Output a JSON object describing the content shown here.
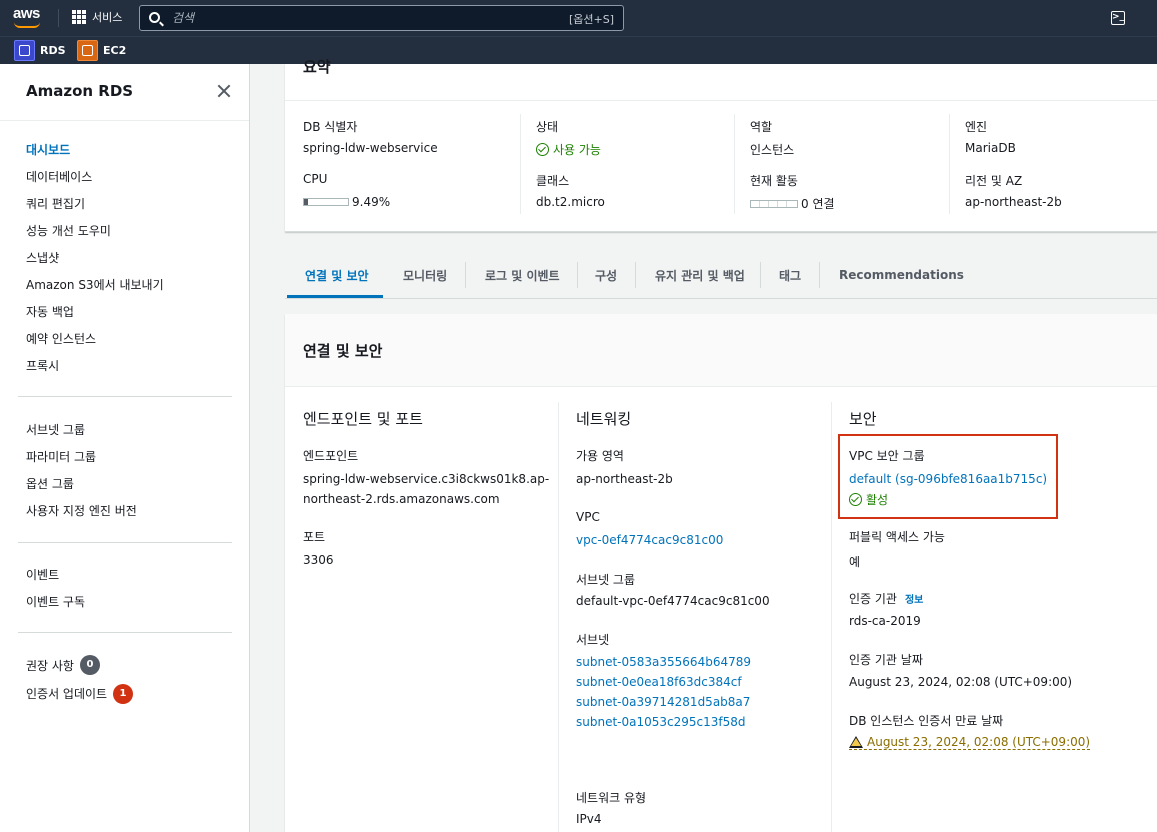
{
  "topnav": {
    "logo_text": "aws",
    "services_label": "서비스",
    "search_placeholder": "검색",
    "search_shortcut": "[옵션+S]",
    "cloudshell_icon": "cloudshell-icon",
    "favorites": [
      {
        "label": "RDS",
        "icon": "rds-icon",
        "color": "#3b48cc"
      },
      {
        "label": "EC2",
        "icon": "ec2-icon",
        "color": "#d86613"
      }
    ]
  },
  "sidebar": {
    "title": "Amazon RDS",
    "section1": [
      "대시보드",
      "데이터베이스",
      "쿼리 편집기",
      "성능 개선 도우미",
      "스냅샷",
      "Amazon S3에서 내보내기",
      "자동 백업",
      "예약 인스턴스",
      "프록시"
    ],
    "section2": [
      "서브넷 그룹",
      "파라미터 그룹",
      "옵션 그룹",
      "사용자 지정 엔진 버전"
    ],
    "section3": [
      "이벤트",
      "이벤트 구독"
    ],
    "section4": [
      {
        "label": "권장 사항",
        "badge": "0"
      },
      {
        "label": "인증서 업데이트",
        "badge": "1"
      }
    ]
  },
  "summary": {
    "title_partial": "요약",
    "db_id_label": "DB 식별자",
    "db_id_value": "spring-ldw-webservice",
    "cpu_label": "CPU",
    "cpu_value": "9.49%",
    "cpu_fraction": 0.0949,
    "status_label": "상태",
    "status_value": "사용 가능",
    "class_label": "클래스",
    "class_value": "db.t2.micro",
    "role_label": "역할",
    "role_value": "인스턴스",
    "activity_label": "현재 활동",
    "activity_value": "0 연결",
    "engine_label": "엔진",
    "engine_value": "MariaDB",
    "region_label": "리전 및 AZ",
    "region_value": "ap-northeast-2b"
  },
  "tabs": [
    "연결 및 보안",
    "모니터링",
    "로그 및 이벤트",
    "구성",
    "유지 관리 및 백업",
    "태그",
    "Recommendations"
  ],
  "active_tab": "연결 및 보안",
  "connectivity": {
    "panel_title": "연결 및 보안",
    "endpoint_section": {
      "title": "엔드포인트 및 포트",
      "endpoint_label": "엔드포인트",
      "endpoint_line1": "spring-ldw-webservice.c3i8ckws01k8.ap-",
      "endpoint_line2": "northeast-2.rds.amazonaws.com",
      "port_label": "포트",
      "port_value": "3306"
    },
    "networking_section": {
      "title": "네트워킹",
      "az_label": "가용 영역",
      "az_value": "ap-northeast-2b",
      "vpc_label": "VPC",
      "vpc_value": "vpc-0ef4774cac9c81c00",
      "subnet_group_label": "서브넷 그룹",
      "subnet_group_value": "default-vpc-0ef4774cac9c81c00",
      "subnets_label": "서브넷",
      "subnets": [
        "subnet-0583a355664b64789",
        "subnet-0e0ea18f63dc384cf",
        "subnet-0a39714281d5ab8a7",
        "subnet-0a1053c295c13f58d"
      ],
      "network_type_label": "네트워크 유형",
      "network_type_value": "IPv4"
    },
    "security_section": {
      "title": "보안",
      "vpc_sg_label": "VPC 보안 그룹",
      "vpc_sg_value": "default (sg-096bfe816aa1b715c)",
      "vpc_sg_status": "활성",
      "public_access_label": "퍼블릭 액세스 가능",
      "public_access_value": "예",
      "ca_label": "인증 기관",
      "ca_info": "정보",
      "ca_value": "rds-ca-2019",
      "ca_date_label": "인증 기관 날짜",
      "ca_date_value": "August 23, 2024, 02:08 (UTC+09:00)",
      "cert_expiry_label": "DB 인스턴스 인증서 만료 날짜",
      "cert_expiry_value": "August 23, 2024, 02:08 (UTC+09:00)"
    }
  },
  "colors": {
    "nav": "#232f3e",
    "link": "#0073bb",
    "success": "#1d8102",
    "highlight": "#d13212",
    "warning": "#8a6d00"
  }
}
